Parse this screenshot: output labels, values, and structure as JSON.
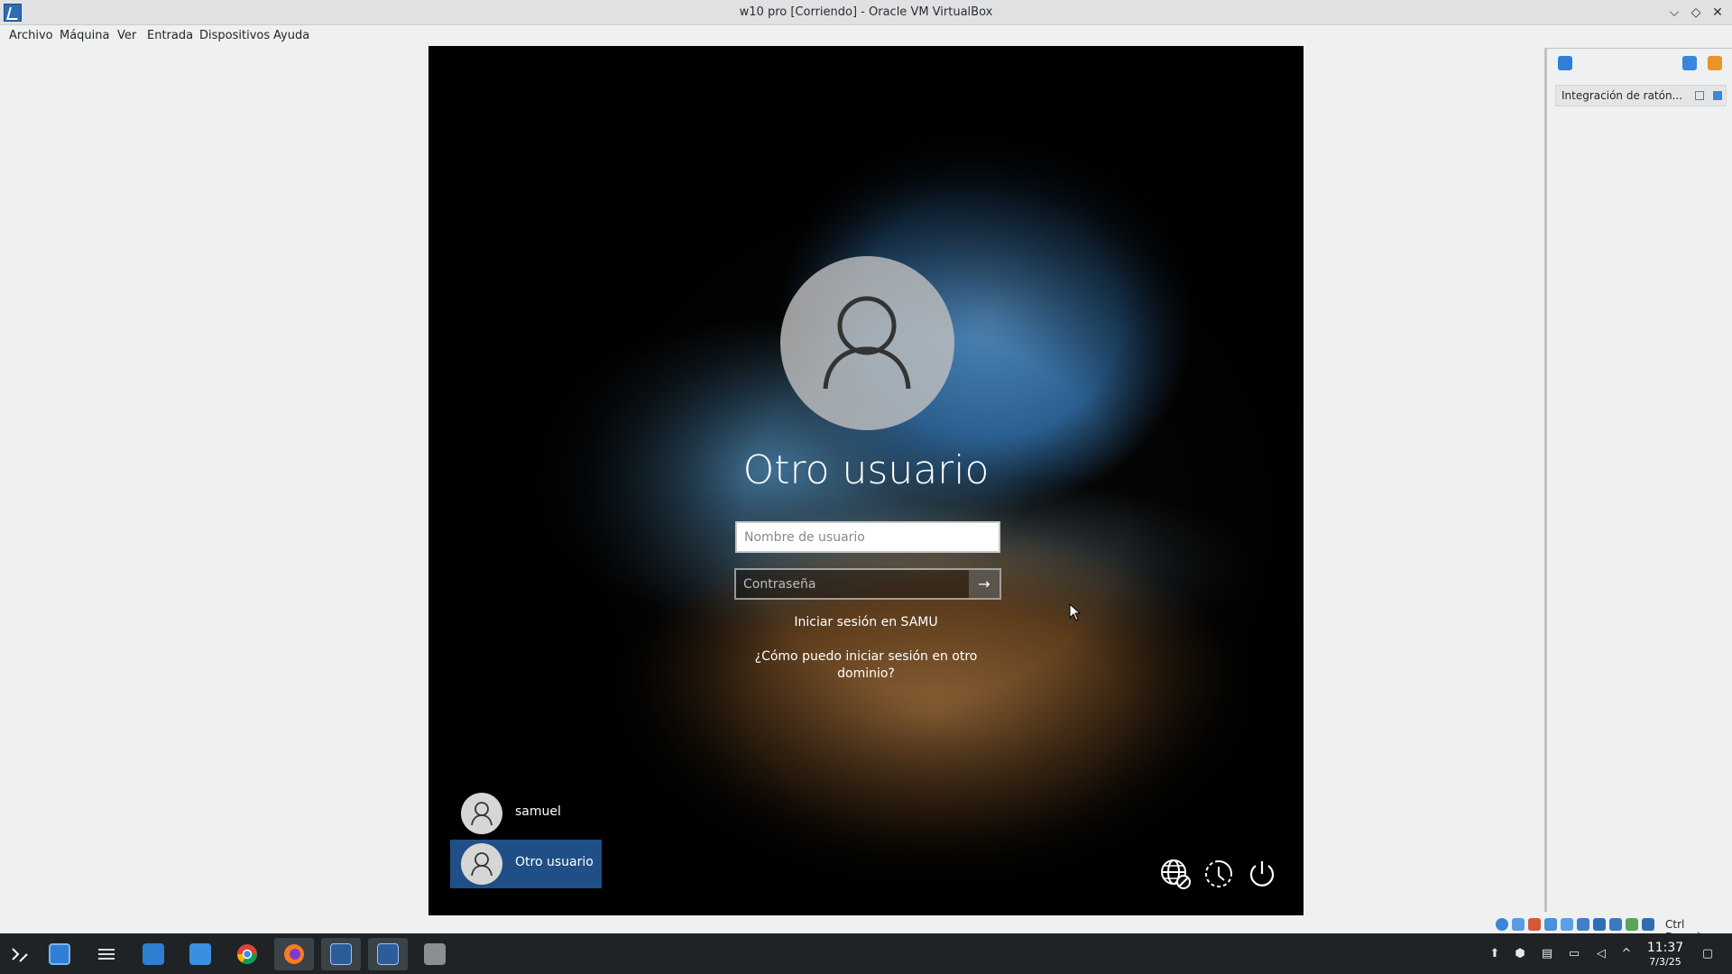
{
  "window": {
    "title": "w10 pro [Corriendo] - Oracle VM VirtualBox",
    "controls": {
      "minimize": "⌵",
      "maximize": "◇",
      "close": "✕"
    }
  },
  "menubar": {
    "items": [
      "Archivo",
      "Máquina",
      "Ver",
      "Entrada",
      "Dispositivos",
      "Ayuda"
    ]
  },
  "vm": {
    "user_title": "Otro usuario",
    "username_placeholder": "Nombre de usuario",
    "password_placeholder": "Contraseña",
    "submit_arrow": "→",
    "signin_domain": "Iniciar sesión en SAMU",
    "other_domain_link": "¿Cómo puedo iniciar sesión en otro dominio?",
    "user_tiles": [
      {
        "label": "samuel",
        "selected": false
      },
      {
        "label": "Otro usuario",
        "selected": true
      }
    ],
    "system_icons": [
      "globe-icon",
      "ease-of-access-icon",
      "power-icon"
    ]
  },
  "side_panel": {
    "mouse_integration_label": "Integración de ratón..."
  },
  "statusbar": {
    "host_key": "Ctrl Derecho"
  },
  "taskbar": {
    "clock_time": "11:37",
    "clock_date": "7/3/25",
    "apps": [
      "launcher-icon",
      "virtual-desktop-icon",
      "settings-icon",
      "store-icon",
      "files-icon",
      "chrome-icon",
      "firefox-icon",
      "vmware-icon",
      "vmware-icon",
      "virtualbox-icon"
    ],
    "tray": [
      "update-icon",
      "package-icon",
      "clipboard-icon",
      "network-icon",
      "volume-muted-icon",
      "chevron-up-icon",
      "show-desktop-icon"
    ]
  },
  "colors": {
    "selected_tile": "#1f4f86",
    "taskbar": "#1f2326"
  }
}
